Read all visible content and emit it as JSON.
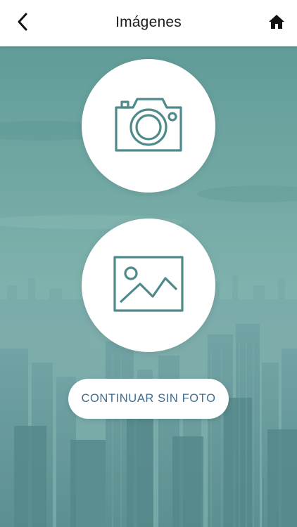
{
  "header": {
    "title": "Imágenes",
    "back_icon": "chevron-left-icon",
    "home_icon": "home-icon"
  },
  "actions": {
    "camera_icon": "camera-icon",
    "gallery_icon": "image-icon",
    "continue_label": "CONTINUAR SIN FOTO"
  },
  "colors": {
    "icon_teal": "#4e8a8a",
    "button_text": "#3d6e93",
    "background_teal": "#5f9a97"
  }
}
